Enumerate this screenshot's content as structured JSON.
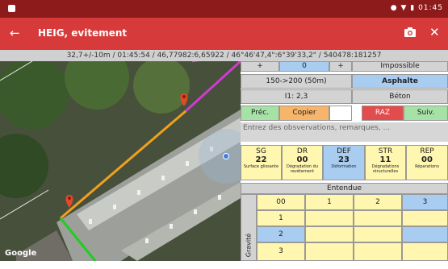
{
  "status": {
    "time": "01:45"
  },
  "appbar": {
    "title": "HEIG, evitement"
  },
  "coords": "32,7+/-10m / 01:45:54 / 46,77982:6,65922 / 46°46'47,4\":6°39'33,2\" / 540478:181257",
  "map": {
    "attribution": "Google"
  },
  "panel": {
    "row1": {
      "left": "+",
      "value": "0",
      "right": "+",
      "quality": "Impossible"
    },
    "row2": {
      "size": "150->200 (50m)",
      "material": "Asphalte"
    },
    "row3": {
      "index": "I1: 2,3",
      "material2": "Béton"
    },
    "actions": {
      "prec": "Préc.",
      "copy": "Copier",
      "raz": "RAZ",
      "next": "Suiv."
    },
    "observations_placeholder": "Entrez des obsvervations, remarques, ...",
    "categories": [
      {
        "code": "SG",
        "value": "22",
        "desc": "Surface glissante"
      },
      {
        "code": "DR",
        "value": "00",
        "desc": "Dégradation du revêtement"
      },
      {
        "code": "DEF",
        "value": "23",
        "desc": "Déformation"
      },
      {
        "code": "STR",
        "value": "11",
        "desc": "Dégradations structurelles"
      },
      {
        "code": "REP",
        "value": "00",
        "desc": "Réparations"
      }
    ],
    "grid": {
      "entendue": "Entendue",
      "gravite": "Gravité",
      "col_headers": [
        "00",
        "1",
        "2",
        "3"
      ],
      "row_headers": [
        "1",
        "2",
        "3"
      ]
    }
  }
}
